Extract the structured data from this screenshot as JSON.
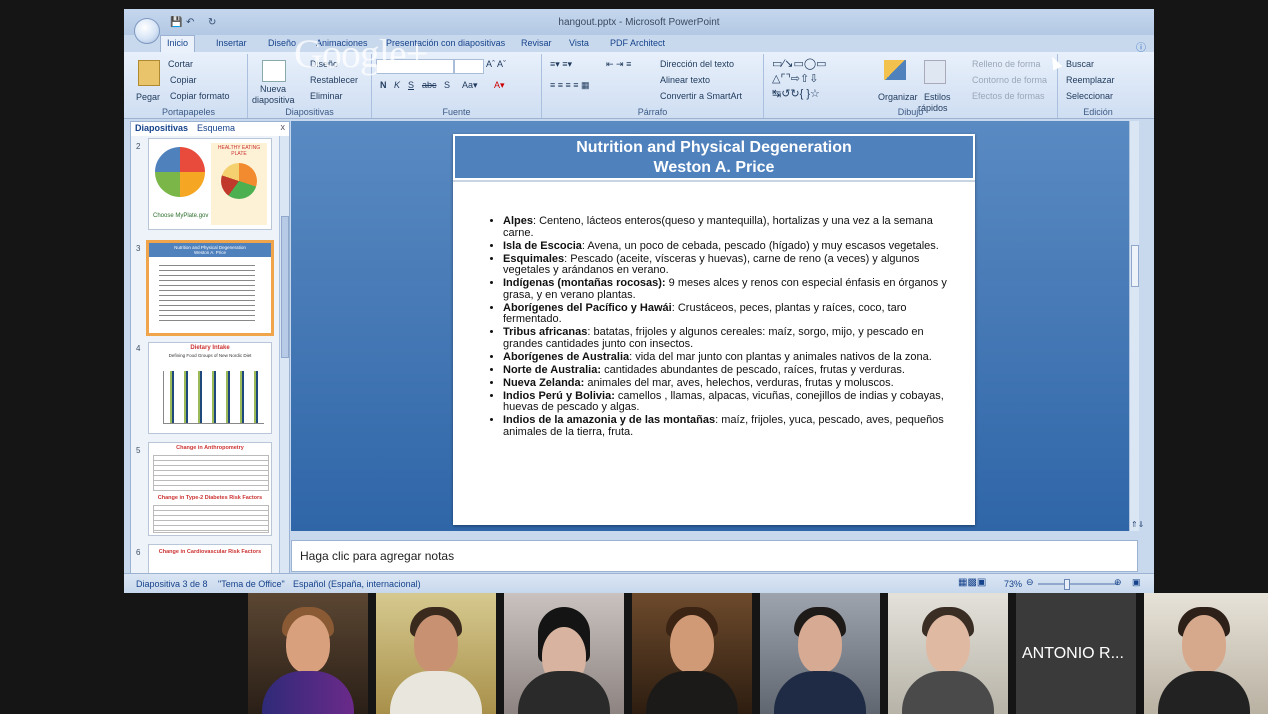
{
  "window": {
    "title": "hangout.pptx - Microsoft PowerPoint"
  },
  "overlay": {
    "logo": "Google+"
  },
  "tabs": [
    "Inicio",
    "Insertar",
    "Diseño",
    "Animaciones",
    "Presentación con diapositivas",
    "Revisar",
    "Vista",
    "PDF Architect"
  ],
  "ribbon": {
    "portapapeles": {
      "label": "Portapapeles",
      "pegar": "Pegar",
      "cortar": "Cortar",
      "copiar": "Copiar",
      "copiar_formato": "Copiar formato"
    },
    "diapositivas": {
      "label": "Diapositivas",
      "nueva": "Nueva",
      "diapositiva": "diapositiva",
      "diseno": "Diseño",
      "restablecer": "Restablecer",
      "eliminar": "Eliminar"
    },
    "fuente": {
      "label": "Fuente"
    },
    "parrafo": {
      "label": "Párrafo",
      "direccion": "Dirección del texto",
      "alinear": "Alinear texto",
      "smartart": "Convertir a SmartArt"
    },
    "dibujo": {
      "label": "Dibujo",
      "organizar": "Organizar",
      "estilos": "Estilos",
      "rapidos": "rápidos",
      "relleno": "Relleno de forma",
      "contorno": "Contorno de forma",
      "efectos": "Efectos de formas"
    },
    "edicion": {
      "label": "Edición",
      "buscar": "Buscar",
      "reemplazar": "Reemplazar",
      "seleccionar": "Seleccionar"
    }
  },
  "panel": {
    "tab_slides": "Diapositivas",
    "tab_outline": "Esquema",
    "close": "x",
    "thumbs": [
      {
        "num": "2",
        "title": "HEALTHY EATING PLATE",
        "sub": "Choose MyPlate.gov"
      },
      {
        "num": "3",
        "title": "Nutrition and Physical Degeneration",
        "sub": "Weston A. Price"
      },
      {
        "num": "4",
        "title": "Dietary Intake",
        "sub": "Defining Food Groups of New Nordic Diet"
      },
      {
        "num": "5",
        "title": "Change in Anthropometry",
        "sub": "Change in Type-2 Diabetes Risk Factors"
      },
      {
        "num": "6",
        "title": "Change in Cardiovascular Risk Factors",
        "sub": ""
      }
    ]
  },
  "slide": {
    "title1": "Nutrition and Physical Degeneration",
    "title2": "Weston A. Price",
    "bullets": [
      {
        "b": "Alpes",
        "t": ": Centeno, lácteos enteros(queso  y mantequilla), hortalizas y una vez a la semana carne."
      },
      {
        "b": "Isla de Escocia",
        "t": ": Avena, un poco de cebada, pescado (hígado) y muy escasos vegetales."
      },
      {
        "b": "Esquimales",
        "t": ": Pescado (aceite, vísceras y huevas), carne de reno (a veces) y algunos vegetales y arándanos en verano."
      },
      {
        "b": "Indígenas (montañas rocosas):",
        "t": " 9 meses alces y renos con especial énfasis en órganos y grasa,  y en verano plantas."
      },
      {
        "b": "Aborígenes del Pacífico y Hawái",
        "t": ": Crustáceos, peces, plantas y raíces, coco, taro fermentado."
      },
      {
        "b": "Tribus africanas",
        "t": ": batatas, frijoles y algunos cereales: maíz, sorgo, mijo, y pescado en grandes cantidades junto con insectos."
      },
      {
        "b": "Aborígenes de Australia",
        "t": ": vida del mar junto con plantas y animales nativos de la zona."
      },
      {
        "b": "Norte de Australia:",
        "t": " cantidades abundantes de pescado, raíces, frutas y verduras."
      },
      {
        "b": "Nueva Zelanda:",
        "t": " animales del mar, aves,  helechos, verduras, frutas y moluscos."
      },
      {
        "b": "Indios Perú y Bolivia:",
        "t": " camellos ,  llamas, alpacas, vicuñas, conejillos de indias y cobayas, huevas de pescado y algas."
      },
      {
        "b": "Indios de la amazonia y de las montañas",
        "t": ": maíz, frijoles, yuca, pescado, aves, pequeños animales de la tierra, fruta."
      }
    ]
  },
  "notes": {
    "placeholder": "Haga clic para agregar notas"
  },
  "status": {
    "slide": "Diapositiva 3 de 8",
    "theme": "\"Tema de Office\"",
    "lang": "Español (España, internacional)",
    "zoom": "73%"
  },
  "participants": {
    "name_tile": "ANTONIO R..."
  },
  "colors": {
    "slide_header": "#4f81bd",
    "editor_bg": "#3f74b5",
    "selection": "#f0a44c"
  }
}
